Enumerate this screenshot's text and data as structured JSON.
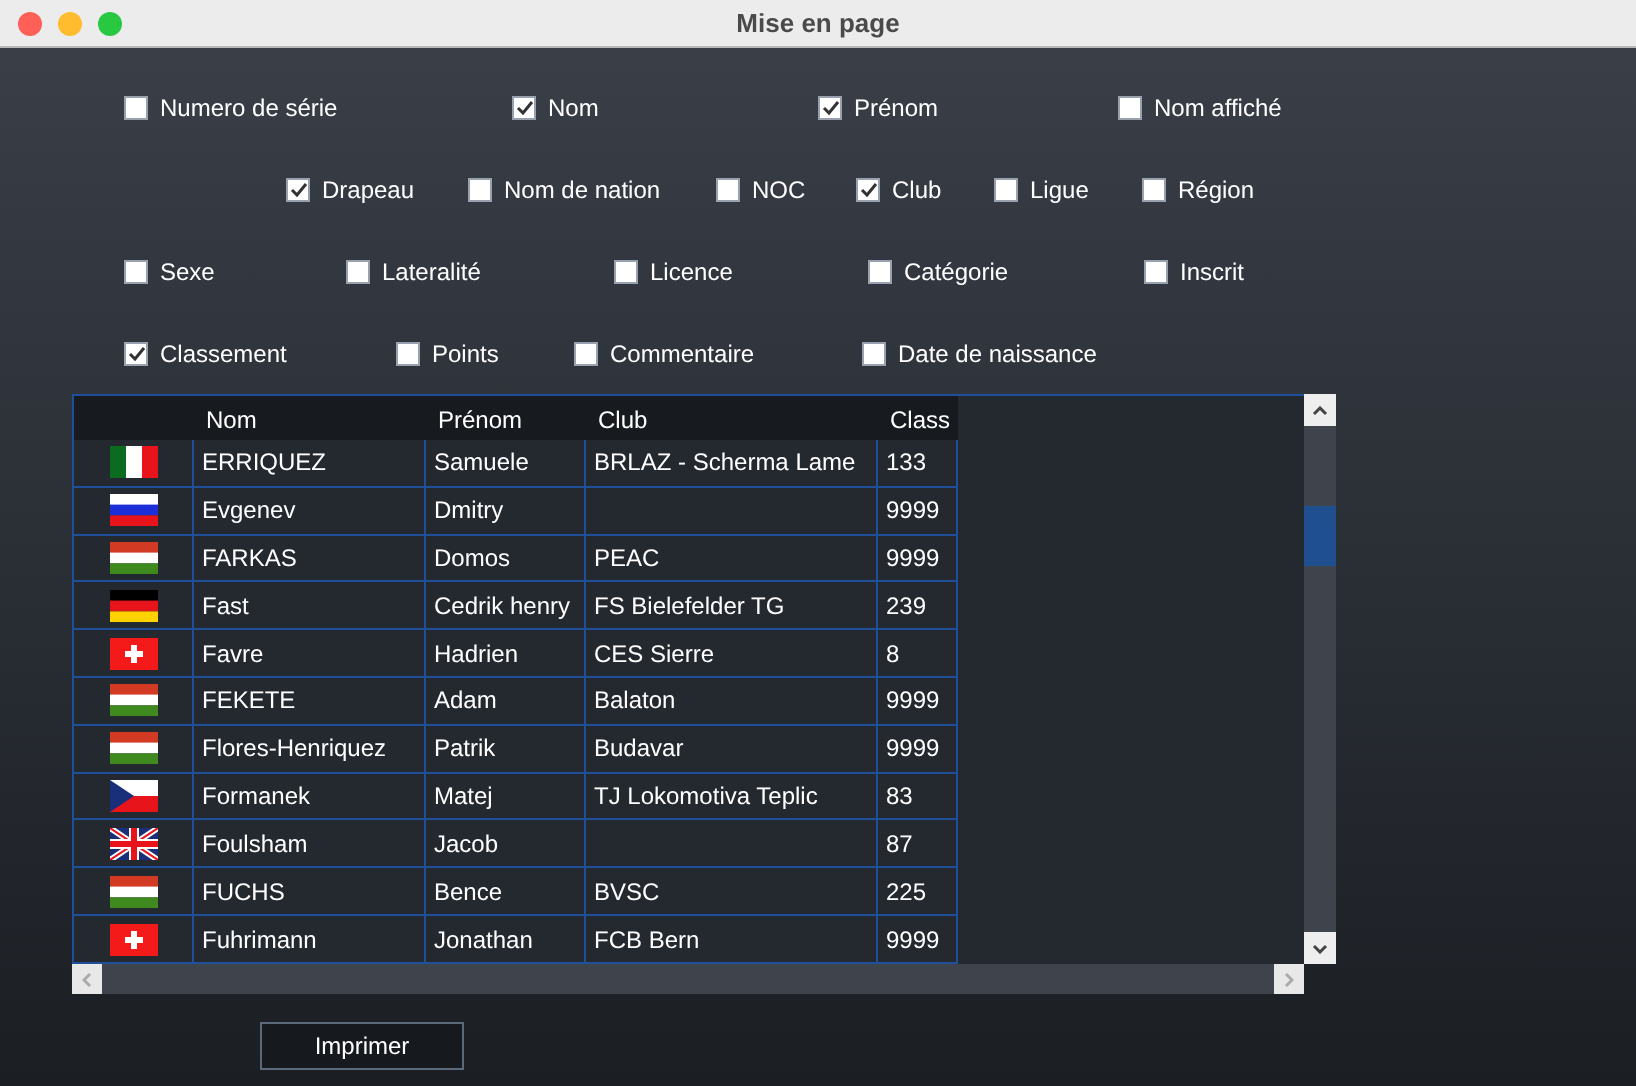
{
  "window": {
    "title": "Mise en page"
  },
  "options": [
    [
      {
        "label": "Numero de série",
        "checked": false
      },
      {
        "label": "Nom",
        "checked": true
      },
      {
        "label": "Prénom",
        "checked": true
      },
      {
        "label": "Nom affiché",
        "checked": false
      }
    ],
    [
      {
        "label": "Drapeau",
        "checked": true
      },
      {
        "label": "Nom de nation",
        "checked": false
      },
      {
        "label": "NOC",
        "checked": false
      },
      {
        "label": "Club",
        "checked": true
      },
      {
        "label": "Ligue",
        "checked": false
      },
      {
        "label": "Région",
        "checked": false
      }
    ],
    [
      {
        "label": "Sexe",
        "checked": false
      },
      {
        "label": "Lateralité",
        "checked": false
      },
      {
        "label": "Licence",
        "checked": false
      },
      {
        "label": "Catégorie",
        "checked": false
      },
      {
        "label": "Inscrit",
        "checked": false
      }
    ],
    [
      {
        "label": "Classement",
        "checked": true
      },
      {
        "label": "Points",
        "checked": false
      },
      {
        "label": "Commentaire",
        "checked": false
      },
      {
        "label": "Date de naissance",
        "checked": false
      }
    ]
  ],
  "table": {
    "columns": [
      "Nom",
      "Prénom",
      "Club",
      "Class"
    ],
    "rows": [
      {
        "kind": "it",
        "cells": [
          "ERRIQUEZ",
          "Samuele",
          "BRLAZ - Scherma Lame",
          "133"
        ]
      },
      {
        "kind": "ru",
        "cells": [
          "Evgenev",
          "Dmitry",
          "",
          "9999"
        ]
      },
      {
        "kind": "hu",
        "cells": [
          "FARKAS",
          "Domos",
          "PEAC",
          "9999"
        ]
      },
      {
        "kind": "de",
        "cells": [
          "Fast",
          "Cedrik henry",
          "FS Bielefelder TG",
          "239"
        ]
      },
      {
        "kind": "ch",
        "cells": [
          "Favre",
          "Hadrien",
          "CES Sierre",
          "8"
        ]
      },
      {
        "kind": "hu",
        "cells": [
          "FEKETE",
          "Adam",
          "Balaton",
          "9999"
        ]
      },
      {
        "kind": "hu",
        "cells": [
          "Flores-Henriquez",
          "Patrik",
          "Budavar",
          "9999"
        ]
      },
      {
        "kind": "cz",
        "cells": [
          "Formanek",
          "Matej",
          "TJ Lokomotiva Teplic",
          "83"
        ]
      },
      {
        "kind": "gb",
        "cells": [
          "Foulsham",
          "Jacob",
          "",
          "87"
        ]
      },
      {
        "kind": "hu",
        "cells": [
          "FUCHS",
          "Bence",
          "BVSC",
          "225"
        ]
      },
      {
        "kind": "ch",
        "cells": [
          "Fuhrimann",
          "Jonathan",
          "FCB Bern",
          "9999"
        ]
      }
    ]
  },
  "print_button": "Imprimer"
}
